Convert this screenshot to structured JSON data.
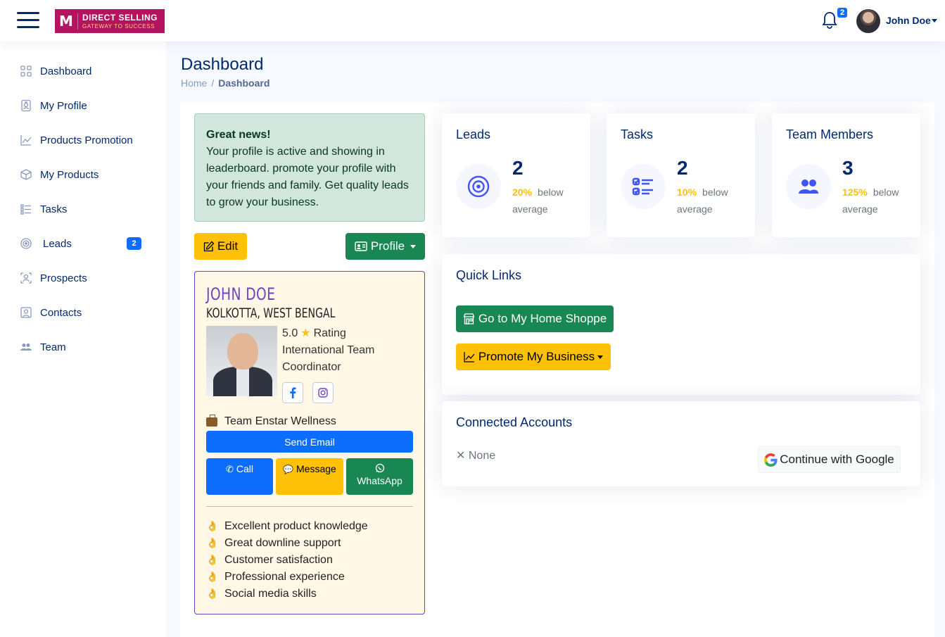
{
  "brand": {
    "title": "DIRECT SELLING",
    "subtitle": "GATEWAY TO SUCCESS",
    "color": "#b5125f"
  },
  "header": {
    "notification_count": "2",
    "user_name": "John Doe"
  },
  "sidebar": {
    "items": [
      {
        "label": "Dashboard",
        "icon": "grid-icon"
      },
      {
        "label": "My Profile",
        "icon": "person-badge-icon"
      },
      {
        "label": "Products Promotion",
        "icon": "graph-up-icon"
      },
      {
        "label": "My Products",
        "icon": "box-icon"
      },
      {
        "label": "Tasks",
        "icon": "list-check-icon"
      },
      {
        "label": "Leads",
        "icon": "bullseye-icon",
        "badge": "2"
      },
      {
        "label": "Prospects",
        "icon": "person-bounding-box-icon"
      },
      {
        "label": "Contacts",
        "icon": "person-square-icon"
      },
      {
        "label": "Team",
        "icon": "people-icon"
      }
    ]
  },
  "page": {
    "title": "Dashboard",
    "breadcrumb": [
      "Home",
      "Dashboard"
    ]
  },
  "alert": {
    "heading": "Great news!",
    "body": "Your profile is active and showing in leaderboard. promote your profile with your friends and family. Get quality leads to grow your business."
  },
  "actions": {
    "edit_label": "Edit",
    "profile_label": "Profile"
  },
  "profile_card": {
    "name": "JOHN DOE",
    "location": "KOLKOTTA, WEST BENGAL",
    "rating": "5.0",
    "rating_label": "Rating",
    "role_line1": "International Team",
    "role_line2": "Coordinator",
    "team": "Team Enstar Wellness",
    "send_email": "Send Email",
    "call": "Call",
    "message": "Message",
    "whatsapp": "WhatsApp",
    "skills": [
      "Excellent product knowledge",
      "Great downline support",
      "Customer satisfaction",
      "Professional experience",
      "Social media skills"
    ]
  },
  "stats": [
    {
      "title": "Leads",
      "value": "2",
      "percent": "20%",
      "note1": "below",
      "note2": "average",
      "icon": "bullseye-icon"
    },
    {
      "title": "Tasks",
      "value": "2",
      "percent": "10%",
      "note1": "below",
      "note2": "average",
      "icon": "list-check-icon"
    },
    {
      "title": "Team Members",
      "value": "3",
      "percent": "125%",
      "note1": "below",
      "note2": "average",
      "icon": "people-icon"
    }
  ],
  "quick_links": {
    "title": "Quick Links",
    "home_shoppe": "Go to My Home Shoppe",
    "promote": "Promote My Business"
  },
  "connected": {
    "title": "Connected Accounts",
    "none": "None",
    "google": "Continue with Google"
  },
  "colors": {
    "primary": "#0d6efd",
    "success": "#198754",
    "warning": "#ffc107",
    "navy": "#012970",
    "accent": "#4154f1"
  }
}
